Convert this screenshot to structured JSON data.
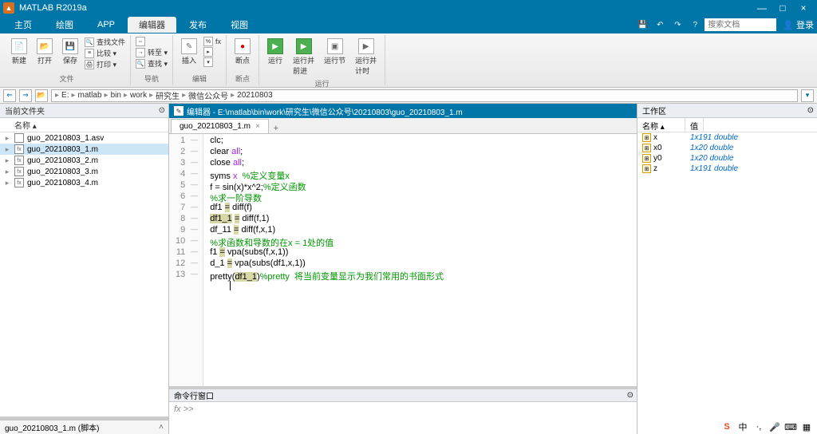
{
  "app": {
    "title": "MATLAB R2019a"
  },
  "window_buttons": {
    "min": "—",
    "max": "□",
    "close": "×"
  },
  "menutabs": [
    "主页",
    "绘图",
    "APP",
    "编辑器",
    "发布",
    "视图"
  ],
  "active_tab_index": 3,
  "right_tools": {
    "search_placeholder": "搜索文档",
    "login": "登录"
  },
  "ribbon": {
    "file": {
      "big": [
        {
          "icon": "📄",
          "label": "新建"
        },
        {
          "icon": "📂",
          "label": "打开"
        },
        {
          "icon": "💾",
          "label": "保存"
        }
      ],
      "small": [
        {
          "icon": "🔍",
          "label": "查找文件"
        },
        {
          "icon": "≡",
          "label": "比较 ▾"
        },
        {
          "icon": "🖨",
          "label": "打印 ▾"
        }
      ],
      "label": "文件"
    },
    "nav": {
      "small": [
        {
          "icon": "⇔",
          "label": ""
        },
        {
          "icon": "→",
          "label": "转至 ▾"
        },
        {
          "icon": "🔍",
          "label": "查找 ▾"
        }
      ],
      "label": "导航"
    },
    "edit": {
      "big": [
        {
          "icon": "✎",
          "label": "插入"
        }
      ],
      "small": [
        {
          "icon": "%",
          "label": "fx"
        },
        {
          "icon": "▸",
          "label": ""
        },
        {
          "icon": "▾",
          "label": ""
        }
      ],
      "label": "编辑"
    },
    "bp": {
      "big": [
        {
          "icon": "●",
          "label": "断点"
        }
      ],
      "label": "断点"
    },
    "run": {
      "items": [
        {
          "icon": "▶",
          "label": "运行"
        },
        {
          "icon": "▶",
          "label": "运行并\n前进"
        },
        {
          "icon": "▣",
          "label": "运行节"
        },
        {
          "icon": "▶",
          "label": "运行并\n计时"
        }
      ],
      "label": "运行"
    }
  },
  "path": {
    "segments": [
      "E:",
      "matlab",
      "bin",
      "work",
      "研究生",
      "微信公众号",
      "20210803"
    ]
  },
  "left": {
    "title": "当前文件夹",
    "col": "名称 ▴",
    "files": [
      {
        "name": "guo_20210803_1.asv",
        "sel": false,
        "icon": ""
      },
      {
        "name": "guo_20210803_1.m",
        "sel": true,
        "icon": "fx"
      },
      {
        "name": "guo_20210803_2.m",
        "sel": false,
        "icon": "fx"
      },
      {
        "name": "guo_20210803_3.m",
        "sel": false,
        "icon": "fx"
      },
      {
        "name": "guo_20210803_4.m",
        "sel": false,
        "icon": "fx"
      }
    ],
    "info": "guo_20210803_1.m (脚本)"
  },
  "editor": {
    "title": "编辑器 - E:\\matlab\\bin\\work\\研究生\\微信公众号\\20210803\\guo_20210803_1.m",
    "tab": "guo_20210803_1.m",
    "lines": [
      [
        {
          "t": "clc;",
          "c": ""
        }
      ],
      [
        {
          "t": "clear ",
          "c": ""
        },
        {
          "t": "all",
          "c": "str"
        },
        {
          "t": ";",
          "c": ""
        }
      ],
      [
        {
          "t": "close ",
          "c": ""
        },
        {
          "t": "all",
          "c": "str"
        },
        {
          "t": ";",
          "c": ""
        }
      ],
      [
        {
          "t": "syms ",
          "c": ""
        },
        {
          "t": "x  ",
          "c": "str"
        },
        {
          "t": "%定义变量x",
          "c": "com"
        }
      ],
      [
        {
          "t": "f = sin(x)*x^2;",
          "c": ""
        },
        {
          "t": "%定义函数",
          "c": "com"
        }
      ],
      [
        {
          "t": "%求一阶导数",
          "c": "com"
        }
      ],
      [
        {
          "t": "df1 ",
          "c": ""
        },
        {
          "t": "=",
          "c": "hl"
        },
        {
          "t": " diff(f)",
          "c": ""
        }
      ],
      [
        {
          "t": "df1_1",
          "c": "hl"
        },
        {
          "t": " ",
          "c": ""
        },
        {
          "t": "=",
          "c": "hl"
        },
        {
          "t": " diff(f,1)",
          "c": ""
        }
      ],
      [
        {
          "t": "df_11 ",
          "c": ""
        },
        {
          "t": "=",
          "c": "hl"
        },
        {
          "t": " diff(f,x,1)",
          "c": ""
        }
      ],
      [
        {
          "t": "%求函数和导数的在x = 1处的值",
          "c": "com"
        }
      ],
      [
        {
          "t": "f1 ",
          "c": ""
        },
        {
          "t": "=",
          "c": "hl"
        },
        {
          "t": " vpa(subs(f,x,1))",
          "c": ""
        }
      ],
      [
        {
          "t": "d_1 ",
          "c": ""
        },
        {
          "t": "=",
          "c": "hl"
        },
        {
          "t": " vpa(subs(df1,x,1))",
          "c": ""
        }
      ],
      [
        {
          "t": "pretty(",
          "c": ""
        },
        {
          "t": "df1_1",
          "c": "hl"
        },
        {
          "t": ")",
          "c": ""
        },
        {
          "t": "%pretty  将当前变量显示为我们常用的书面形式",
          "c": "com"
        }
      ]
    ]
  },
  "cmd": {
    "title": "命令行窗口",
    "prompt": "fx >>"
  },
  "ws": {
    "title": "工作区",
    "cols": [
      "名称 ▴",
      "值"
    ],
    "vars": [
      {
        "name": "x",
        "value": "1x191 double"
      },
      {
        "name": "x0",
        "value": "1x20 double"
      },
      {
        "name": "y0",
        "value": "1x20 double"
      },
      {
        "name": "z",
        "value": "1x191 double"
      }
    ]
  }
}
